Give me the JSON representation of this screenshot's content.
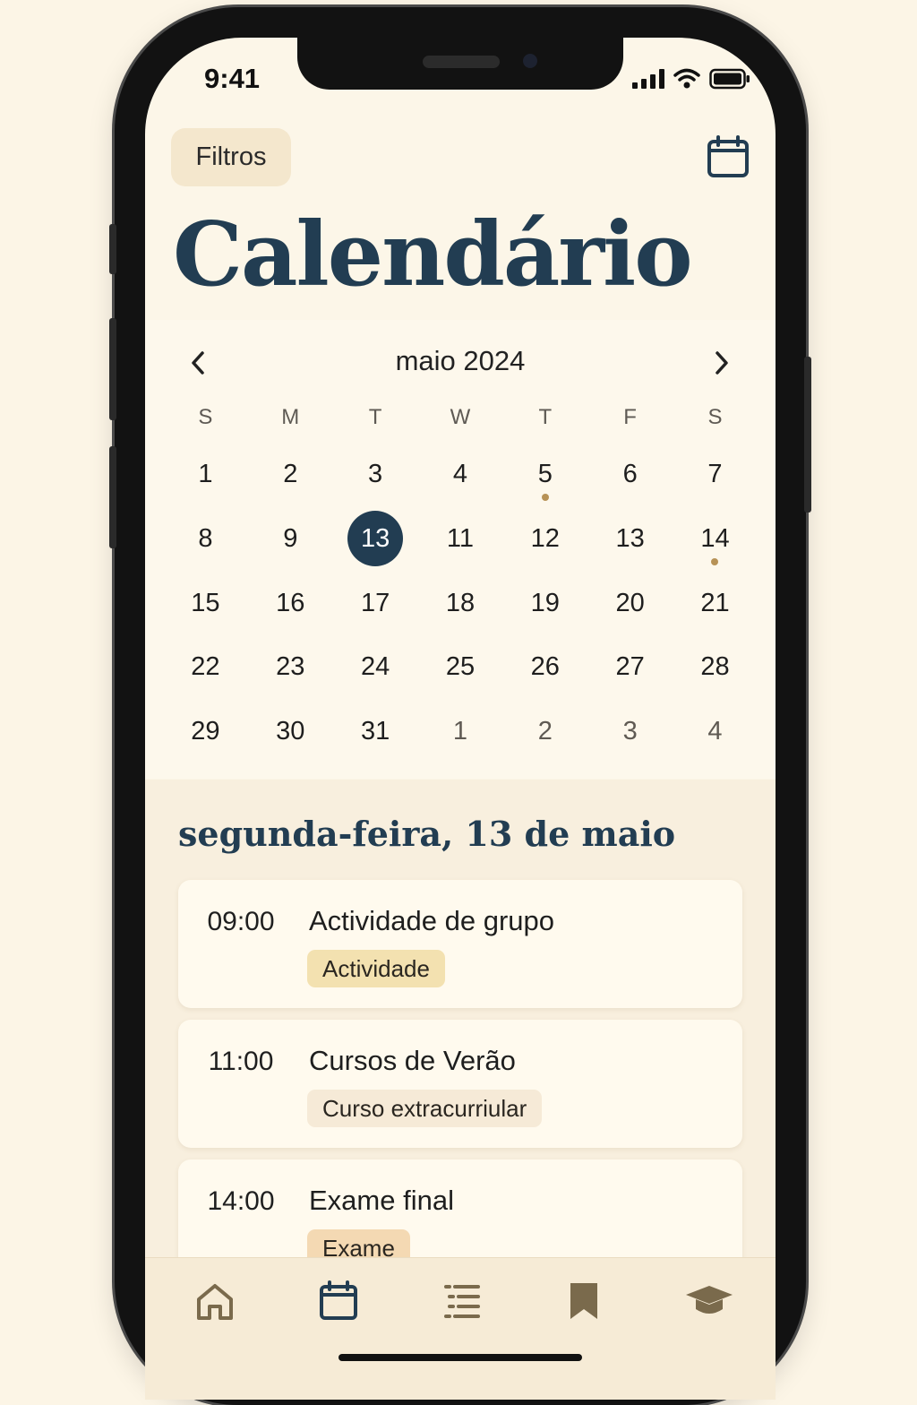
{
  "status_bar": {
    "time": "9:41"
  },
  "header": {
    "filter_label": "Filtros",
    "calendar_icon": "calendar-icon",
    "title": "Calendário"
  },
  "calendar": {
    "month_label": "maio 2024",
    "prev_icon": "chevron-left-icon",
    "next_icon": "chevron-right-icon",
    "weekdays": [
      "S",
      "M",
      "T",
      "W",
      "T",
      "F",
      "S"
    ],
    "weeks": [
      [
        {
          "day": "1"
        },
        {
          "day": "2"
        },
        {
          "day": "3"
        },
        {
          "day": "4"
        },
        {
          "day": "5",
          "event_dot": true
        },
        {
          "day": "6"
        },
        {
          "day": "7"
        }
      ],
      [
        {
          "day": "8"
        },
        {
          "day": "9"
        },
        {
          "day": "13",
          "selected": true
        },
        {
          "day": "11"
        },
        {
          "day": "12"
        },
        {
          "day": "13"
        },
        {
          "day": "14",
          "event_dot": true
        }
      ],
      [
        {
          "day": "15"
        },
        {
          "day": "16"
        },
        {
          "day": "17"
        },
        {
          "day": "18"
        },
        {
          "day": "19"
        },
        {
          "day": "20"
        },
        {
          "day": "21"
        }
      ],
      [
        {
          "day": "22"
        },
        {
          "day": "23"
        },
        {
          "day": "24"
        },
        {
          "day": "25"
        },
        {
          "day": "26"
        },
        {
          "day": "27"
        },
        {
          "day": "28"
        }
      ],
      [
        {
          "day": "29"
        },
        {
          "day": "30"
        },
        {
          "day": "31"
        },
        {
          "day": "1",
          "other_month": true
        },
        {
          "day": "2",
          "other_month": true
        },
        {
          "day": "3",
          "other_month": true
        },
        {
          "day": "4",
          "other_month": true
        }
      ]
    ]
  },
  "events_section": {
    "heading": "segunda-feira, 13 de maio",
    "events": [
      {
        "time": "09:00",
        "title": "Actividade de grupo",
        "tag": "Actividade",
        "tag_color": "#f3e1b0"
      },
      {
        "time": "11:00",
        "title": "Cursos de Verão",
        "tag": "Curso extracurriular",
        "tag_color": "#f6ead7"
      },
      {
        "time": "14:00",
        "title": "Exame final",
        "tag": "Exame",
        "tag_color": "#f4d9b3"
      }
    ]
  },
  "tab_bar": {
    "items": [
      {
        "icon": "home-icon"
      },
      {
        "icon": "calendar-icon"
      },
      {
        "icon": "list-icon"
      },
      {
        "icon": "bookmark-icon"
      },
      {
        "icon": "graduation-cap-icon"
      }
    ]
  },
  "colors": {
    "accent": "#223d52",
    "event_dot": "#b79256",
    "background": "#fcf6e8",
    "tab_icon": "#7a6a4c"
  }
}
